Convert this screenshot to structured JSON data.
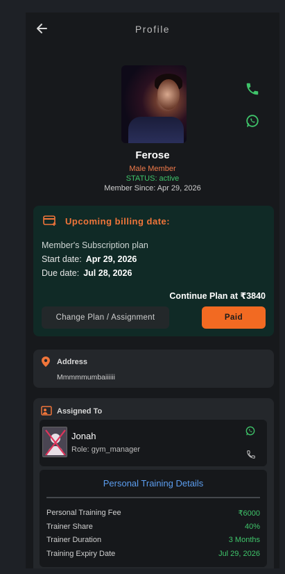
{
  "header": {
    "title": "Profile",
    "back_icon": "arrow-left-icon"
  },
  "profile": {
    "name": "Ferose",
    "member_type": "Male Member",
    "status": "STATUS: active",
    "member_since": "Member Since: Apr 29, 2026"
  },
  "contact": {
    "call_icon": "phone-icon",
    "whatsapp_icon": "whatsapp-icon",
    "color": "#3fc46a"
  },
  "billing": {
    "heading": "Upcoming billing date:",
    "plan_label": "Member's Subscription plan",
    "start_label": "Start date:",
    "start_value": "Apr 29, 2026",
    "due_label": "Due date:",
    "due_value": "Jul 28, 2026",
    "continue_text": "Continue Plan at  ₹3840",
    "change_button": "Change Plan / Assignment",
    "paid_button": "Paid",
    "accent": "#f26a22"
  },
  "address": {
    "label": "Address",
    "value": "Mmmmmumbaiiiiii"
  },
  "assigned": {
    "label": "Assigned To",
    "trainer_name": "Jonah",
    "trainer_role": "Role: gym_manager"
  },
  "training": {
    "title": "Personal Training Details",
    "rows": [
      {
        "key": "Personal Training Fee",
        "value": "₹6000"
      },
      {
        "key": "Trainer Share",
        "value": "40%"
      },
      {
        "key": "Trainer Duration",
        "value": "3 Months"
      },
      {
        "key": "Training Expiry Date",
        "value": "Jul 29, 2026"
      }
    ]
  }
}
